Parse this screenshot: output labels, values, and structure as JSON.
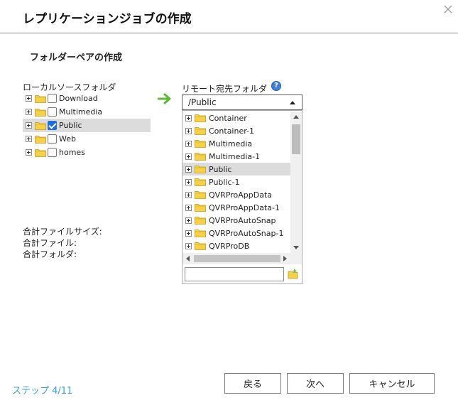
{
  "dialog": {
    "title": "レプリケーションジョブの作成",
    "section_title": "フォルダーペアの作成"
  },
  "local": {
    "label": "ローカルソースフォルダ",
    "folders": [
      {
        "name": "Download",
        "checked": false,
        "selected": false
      },
      {
        "name": "Multimedia",
        "checked": false,
        "selected": false
      },
      {
        "name": "Public",
        "checked": true,
        "selected": true
      },
      {
        "name": "Web",
        "checked": false,
        "selected": false
      },
      {
        "name": "homes",
        "checked": false,
        "selected": false
      }
    ]
  },
  "remote": {
    "label": "リモート宛先フォルダ",
    "help_icon": "question-help-icon",
    "selected_path": "/Public",
    "folders": [
      {
        "name": "Container",
        "selected": false
      },
      {
        "name": "Container-1",
        "selected": false
      },
      {
        "name": "Multimedia",
        "selected": false
      },
      {
        "name": "Multimedia-1",
        "selected": false
      },
      {
        "name": "Public",
        "selected": true
      },
      {
        "name": "Public-1",
        "selected": false
      },
      {
        "name": "QVRProAppData",
        "selected": false
      },
      {
        "name": "QVRProAppData-1",
        "selected": false
      },
      {
        "name": "QVRProAutoSnap",
        "selected": false
      },
      {
        "name": "QVRProAutoSnap-1",
        "selected": false
      },
      {
        "name": "QVRProDB",
        "selected": false
      }
    ],
    "new_folder_value": ""
  },
  "totals": {
    "file_size_label": "合計ファイルサイズ:",
    "files_label": "合計ファイル:",
    "folders_label": "合計フォルダ:"
  },
  "footer": {
    "step": "ステップ 4/11",
    "back_label": "戻る",
    "next_label": "次へ",
    "cancel_label": "キャンセル"
  },
  "colors": {
    "accent": "#3a9fd8",
    "check": "#1e6fd9",
    "arrow": "#5db833",
    "folder": "#f5d04a",
    "selection": "#dcdcdc"
  }
}
